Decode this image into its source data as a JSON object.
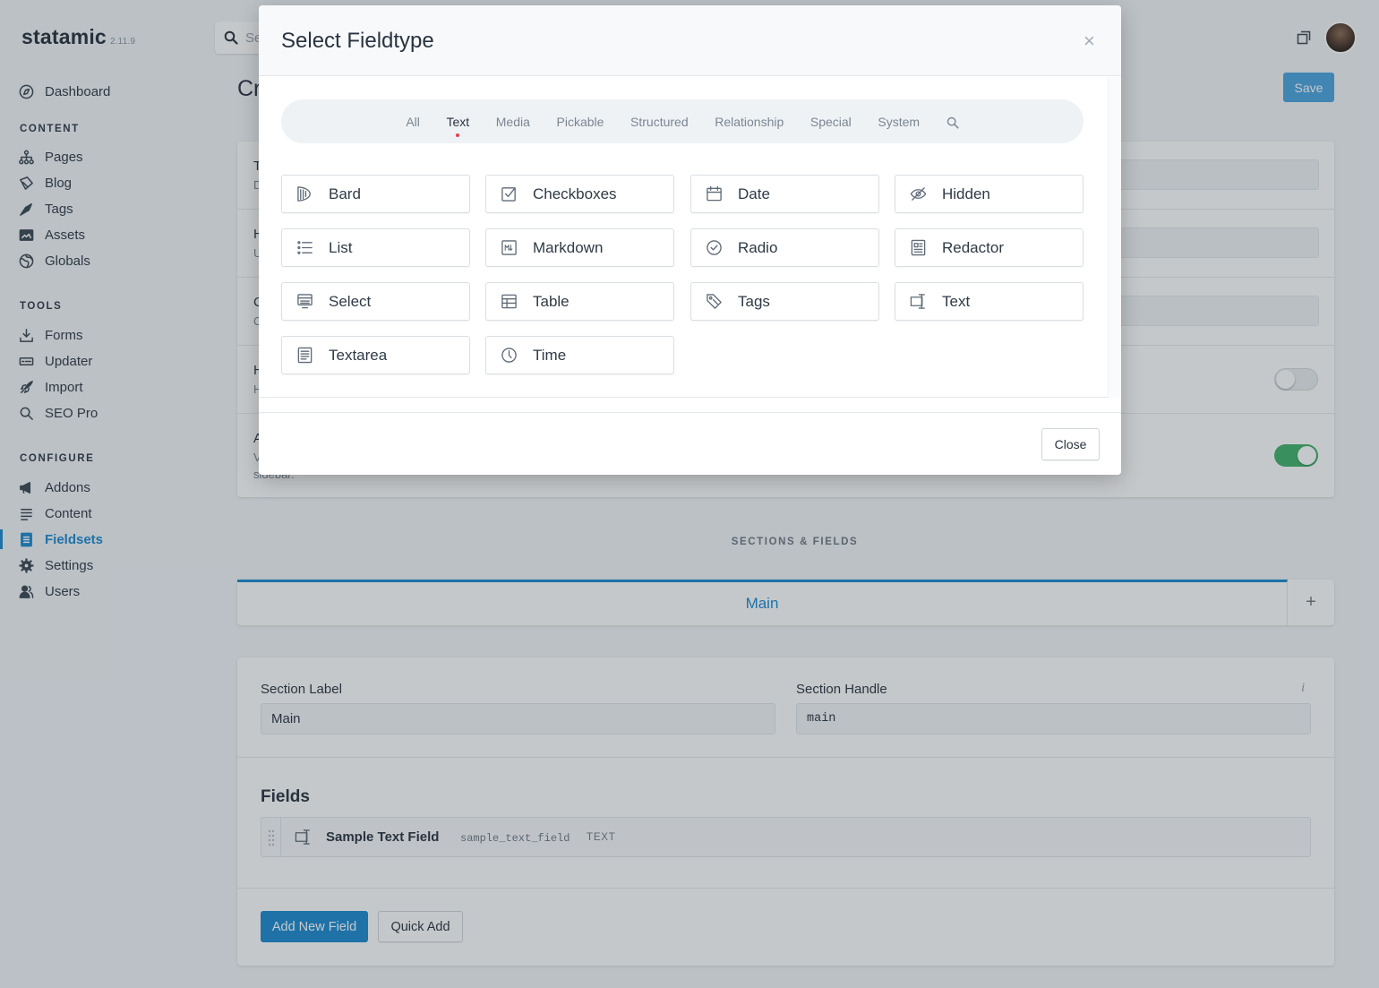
{
  "app": {
    "name": "statamic",
    "version": "2.11.9"
  },
  "sidebar": {
    "dashboard": {
      "label": "Dashboard",
      "icon": "dashboard-icon"
    },
    "sections": [
      {
        "heading": "CONTENT",
        "items": [
          {
            "label": "Pages",
            "icon": "sitemap-icon"
          },
          {
            "label": "Blog",
            "icon": "blog-icon"
          },
          {
            "label": "Tags",
            "icon": "tag-icon"
          },
          {
            "label": "Assets",
            "icon": "image-icon"
          },
          {
            "label": "Globals",
            "icon": "globe-icon"
          }
        ]
      },
      {
        "heading": "TOOLS",
        "items": [
          {
            "label": "Forms",
            "icon": "download-icon"
          },
          {
            "label": "Updater",
            "icon": "updater-icon"
          },
          {
            "label": "Import",
            "icon": "rocket-icon"
          },
          {
            "label": "SEO Pro",
            "icon": "search-icon"
          }
        ]
      },
      {
        "heading": "CONFIGURE",
        "items": [
          {
            "label": "Addons",
            "icon": "megaphone-icon"
          },
          {
            "label": "Content",
            "icon": "lines-icon"
          },
          {
            "label": "Fieldsets",
            "icon": "fieldset-icon",
            "active": true
          },
          {
            "label": "Settings",
            "icon": "gear-icon"
          },
          {
            "label": "Users",
            "icon": "users-icon"
          }
        ]
      }
    ]
  },
  "topbar": {
    "search_fragment": "Se",
    "save_label": "Save"
  },
  "page": {
    "title_fragment": "Cr"
  },
  "behind": {
    "frag1": "T",
    "frag1b": "D",
    "frag2": "H",
    "frag2b": "U",
    "frag3": "C",
    "frag3b": "C",
    "frag4": "H",
    "frag4b": "H",
    "frag5": "A",
    "frag5b": "V",
    "sidebar_word": "sidebar."
  },
  "sections_fields": {
    "heading": "SECTIONS & FIELDS",
    "tab_main": "Main",
    "tab_add": "+",
    "section_label": {
      "label": "Section Label",
      "value": "Main"
    },
    "section_handle": {
      "label": "Section Handle",
      "value": "main",
      "info": "i"
    },
    "fields_heading": "Fields",
    "fields": [
      {
        "name": "Sample Text Field",
        "handle": "sample_text_field",
        "type": "TEXT"
      }
    ],
    "add_new_field": "Add New Field",
    "quick_add": "Quick Add"
  },
  "modal": {
    "title": "Select Fieldtype",
    "close_x": "×",
    "filter_tabs": [
      "All",
      "Text",
      "Media",
      "Pickable",
      "Structured",
      "Relationship",
      "Special",
      "System"
    ],
    "active_tab": "Text",
    "fieldtypes": [
      {
        "label": "Bard",
        "icon": "bard-icon"
      },
      {
        "label": "Checkboxes",
        "icon": "checkbox-icon"
      },
      {
        "label": "Date",
        "icon": "calendar-icon"
      },
      {
        "label": "Hidden",
        "icon": "eye-slash-icon"
      },
      {
        "label": "List",
        "icon": "list-icon"
      },
      {
        "label": "Markdown",
        "icon": "markdown-icon"
      },
      {
        "label": "Radio",
        "icon": "radio-icon"
      },
      {
        "label": "Redactor",
        "icon": "redactor-icon"
      },
      {
        "label": "Select",
        "icon": "select-icon"
      },
      {
        "label": "Table",
        "icon": "table-icon"
      },
      {
        "label": "Tags",
        "icon": "tag-icon"
      },
      {
        "label": "Text",
        "icon": "text-icon"
      },
      {
        "label": "Textarea",
        "icon": "textarea-icon"
      },
      {
        "label": "Time",
        "icon": "clock-icon"
      }
    ],
    "close_label": "Close"
  },
  "colors": {
    "accent": "#1b8ad1",
    "save": "#4aa3e0",
    "toggle_on": "#3fb36b",
    "active_dot": "#e0434b"
  }
}
